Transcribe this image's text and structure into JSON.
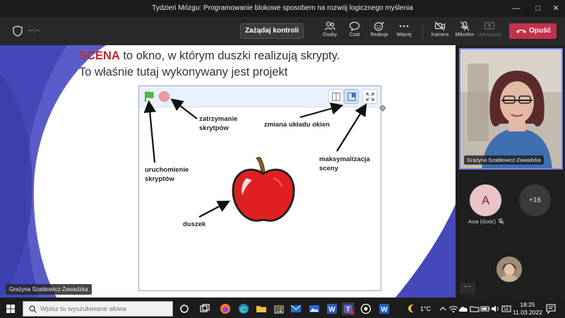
{
  "window": {
    "title": "Tydzień Mózgu: Programowanie blokowe sposobem na rozwój logicznego myślenia"
  },
  "toolbar": {
    "timer": "--:--",
    "request_control_label": "Zażądaj kontroli",
    "people_label": "Osoby",
    "chat_label": "Czat",
    "reactions_label": "Reakcje",
    "more_label": "Więcej",
    "camera_label": "Kamera",
    "mic_label": "Mikrofon",
    "share_label": "Udostępnij",
    "leave_label": "Opuść"
  },
  "slide": {
    "heading_accent": "SCENA",
    "heading_rest": " to okno, w którym duszki realizują skrypty.",
    "subheading": "To właśnie tutaj wykonywany jest projekt",
    "annotations": {
      "stop": [
        "zatrzymanie",
        "skrytpów"
      ],
      "layout": "zmiana układu okien",
      "maximize": [
        "maksymalizacja",
        "sceny"
      ],
      "run": [
        "uruchomienie",
        "skryptów"
      ],
      "sprite": "duszek"
    },
    "presenter_tag": "Grażyna Szabłowicz-Zawadzka"
  },
  "participants": {
    "main_video_name": "Grażyna Szabłowicz-Zawadzka",
    "guest_initial": "A",
    "guest_name": "Asia (Gość)",
    "more_count": "+16",
    "more_options": "···"
  },
  "taskbar": {
    "search_placeholder": "Wpisz tu wyszukiwane słowa",
    "temperature": "1°C",
    "time": "18:25",
    "date": "11.03.2022"
  },
  "colors": {
    "accent_red": "#c0272d",
    "leave_red": "#c4314b",
    "teams_purple": "#7b83eb"
  }
}
